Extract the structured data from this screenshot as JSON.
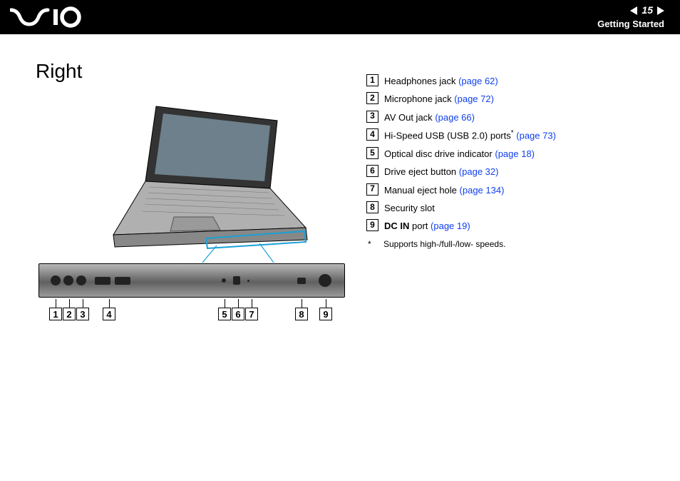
{
  "header": {
    "page_number": "15",
    "section": "Getting Started",
    "logo_name": "VAIO"
  },
  "title": "Right",
  "legend": [
    {
      "num": "1",
      "label": "Headphones jack",
      "suffix": "",
      "link": "(page 62)"
    },
    {
      "num": "2",
      "label": "Microphone jack",
      "suffix": "",
      "link": "(page 72)"
    },
    {
      "num": "3",
      "label": "AV Out jack",
      "suffix": "",
      "link": "(page 66)"
    },
    {
      "num": "4",
      "label": "Hi-Speed USB (USB 2.0) ports",
      "suffix": "*",
      "link": "(page 73)"
    },
    {
      "num": "5",
      "label": "Optical disc drive indicator",
      "suffix": "",
      "link": "(page 18)"
    },
    {
      "num": "6",
      "label": "Drive eject button",
      "suffix": "",
      "link": "(page 32)"
    },
    {
      "num": "7",
      "label": "Manual eject hole",
      "suffix": "",
      "link": "(page 134)"
    },
    {
      "num": "8",
      "label": "Security slot",
      "suffix": "",
      "link": ""
    },
    {
      "num": "9",
      "label_bold": "DC IN",
      "label_rest": " port",
      "link": "(page 19)"
    }
  ],
  "footnote": {
    "mark": "*",
    "text": "Supports high-/full-/low- speeds."
  },
  "callout_numbers": [
    "1",
    "2",
    "3",
    "4",
    "5",
    "6",
    "7",
    "8",
    "9"
  ]
}
